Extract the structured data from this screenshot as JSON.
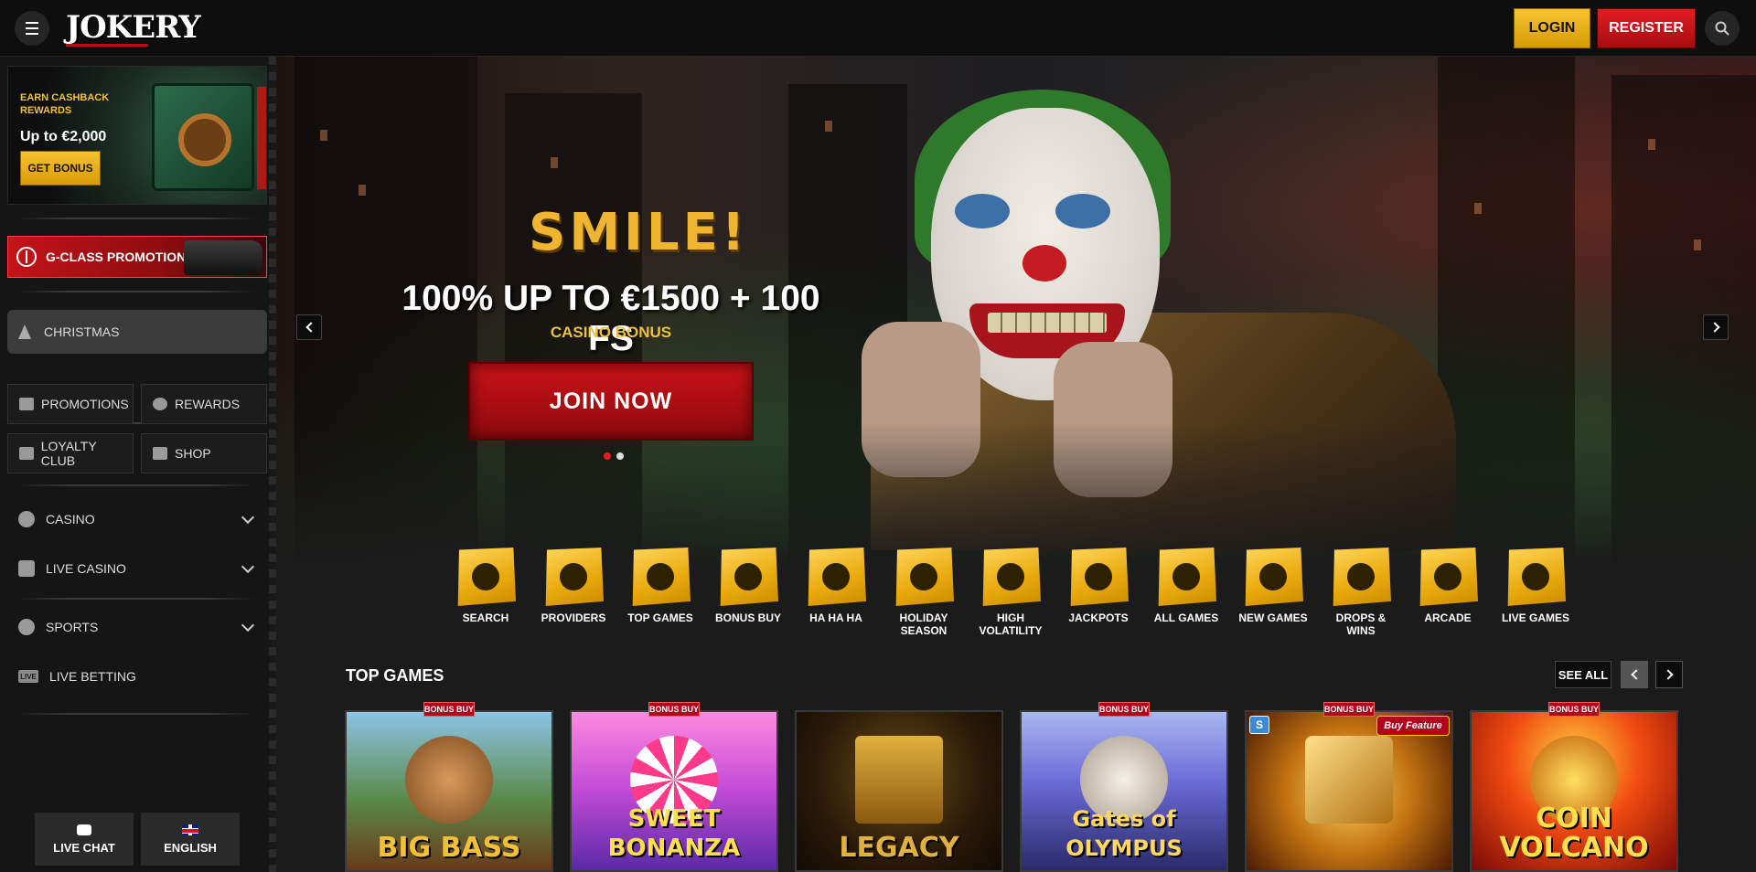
{
  "header": {
    "logo": "JOKERY",
    "login_label": "LOGIN",
    "register_label": "REGISTER",
    "menu_icon": "hamburger-icon",
    "search_icon": "search-icon"
  },
  "sidebar": {
    "cashback": {
      "label": "EARN CASHBACK REWARDS",
      "amount": "Up to €2,000",
      "button_label": "GET BONUS"
    },
    "gclass_label": "G-CLASS PROMOTION",
    "christmas_label": "CHRISTMAS",
    "tiles": [
      {
        "label": "PROMOTIONS",
        "icon": "gift-icon"
      },
      {
        "label": "REWARDS",
        "icon": "chip-icon"
      },
      {
        "label": "LOYALTY CLUB",
        "icon": "crown-icon"
      },
      {
        "label": "SHOP",
        "icon": "shop-icon"
      }
    ],
    "nav": [
      {
        "label": "CASINO",
        "icon": "casino-chip-icon"
      },
      {
        "label": "LIVE CASINO",
        "icon": "cards-icon"
      },
      {
        "label": "SPORTS",
        "icon": "soccer-ball-icon"
      },
      {
        "label": "LIVE BETTING",
        "icon": "live-icon",
        "badge": "LIVE"
      }
    ],
    "live_chat_label": "LIVE CHAT",
    "language_label": "ENGLISH"
  },
  "hero": {
    "title": "SMILE!",
    "subtitle": "100% UP TO €1500 + 100 FS",
    "caption": "CASINO BONUS",
    "cta_label": "JOIN NOW",
    "slides": 2,
    "active_slide": 1
  },
  "categories": [
    {
      "label": "SEARCH",
      "icon": "search-icon"
    },
    {
      "label": "PROVIDERS",
      "icon": "globe-icon"
    },
    {
      "label": "TOP GAMES",
      "icon": "diamond-icon"
    },
    {
      "label": "BONUS BUY",
      "icon": "money-bag-icon"
    },
    {
      "label": "HA HA HA",
      "icon": "joker-grin-icon"
    },
    {
      "label": "HOLIDAY SEASON",
      "icon": "christmas-tree-icon"
    },
    {
      "label": "HIGH VOLATILITY",
      "icon": "gauge-icon"
    },
    {
      "label": "JACKPOTS",
      "icon": "crown-jewel-icon"
    },
    {
      "label": "ALL GAMES",
      "icon": "slot-machine-icon"
    },
    {
      "label": "NEW GAMES",
      "icon": "rocket-icon"
    },
    {
      "label": "DROPS & WINS",
      "icon": "drops-wins-icon"
    },
    {
      "label": "ARCADE",
      "icon": "arcade-icon"
    },
    {
      "label": "LIVE GAMES",
      "icon": "dealer-icon"
    }
  ],
  "top_games": {
    "title": "TOP GAMES",
    "see_all_label": "SEE ALL",
    "bonus_buy_label": "BONUS BUY",
    "feature_label": "Buy Feature",
    "provider_label": "S",
    "games": [
      {
        "name": "BIG BASS",
        "bonus_buy": true,
        "colors": [
          "#5aa6d6",
          "#8a5a2a"
        ]
      },
      {
        "name": "SWEET BONANZA",
        "bonus_buy": true,
        "colors": [
          "#e85bd0",
          "#7a3ad6"
        ]
      },
      {
        "name": "LEGACY",
        "bonus_buy": false,
        "colors": [
          "#3a2a10",
          "#1a1208"
        ]
      },
      {
        "name": "Gates of OLYMPUS",
        "bonus_buy": true,
        "colors": [
          "#6a7fd6",
          "#2a2a6a"
        ]
      },
      {
        "name": "",
        "bonus_buy": true,
        "colors": [
          "#f0a020",
          "#7a3a08"
        ]
      },
      {
        "name": "COIN VOLCANO",
        "bonus_buy": true,
        "colors": [
          "#f04a10",
          "#7a0a08"
        ]
      }
    ]
  }
}
